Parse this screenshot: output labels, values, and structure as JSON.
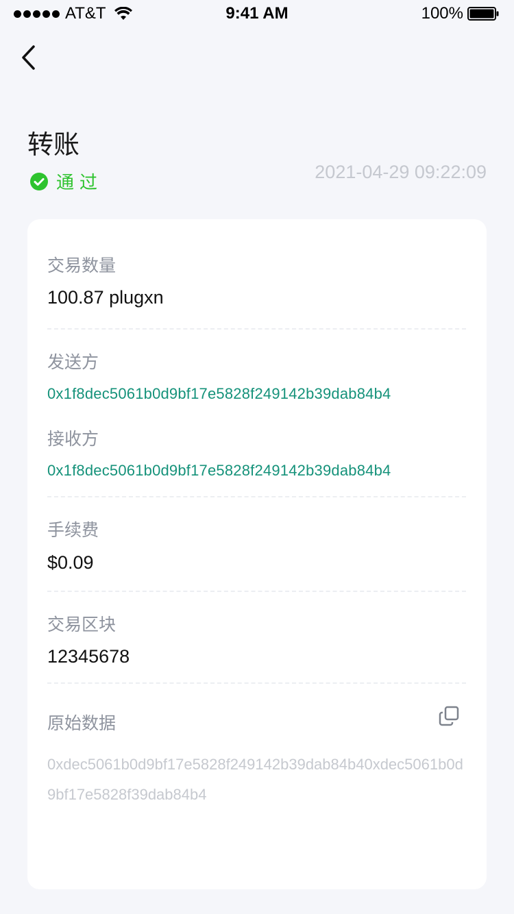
{
  "status_bar": {
    "carrier": "AT&T",
    "time": "9:41 AM",
    "battery_percent": "100%",
    "battery_level": 1.0
  },
  "header": {
    "title": "转账",
    "status": "通过",
    "timestamp": "2021-04-29 09:22:09"
  },
  "details": {
    "amount_label": "交易数量",
    "amount_value": "100.87 plugxn",
    "sender_label": "发送方",
    "sender_address": "0x1f8dec5061b0d9bf17e5828f249142b39dab84b4",
    "receiver_label": "接收方",
    "receiver_address": "0x1f8dec5061b0d9bf17e5828f249142b39dab84b4",
    "fee_label": "手续费",
    "fee_value": "$0.09",
    "block_label": "交易区块",
    "block_value": "12345678",
    "raw_label": "原始数据",
    "raw_value": "0xdec5061b0d9bf17e5828f249142b39dab84b40xdec5061b0d9bf17e5828f39dab84b4"
  },
  "colors": {
    "status_green": "#2ec32e",
    "address_green": "#15927a",
    "background": "#f5f6fa"
  },
  "icons": {
    "back": "chevron-left-icon",
    "status": "check-circle-icon",
    "copy": "copy-icon"
  }
}
